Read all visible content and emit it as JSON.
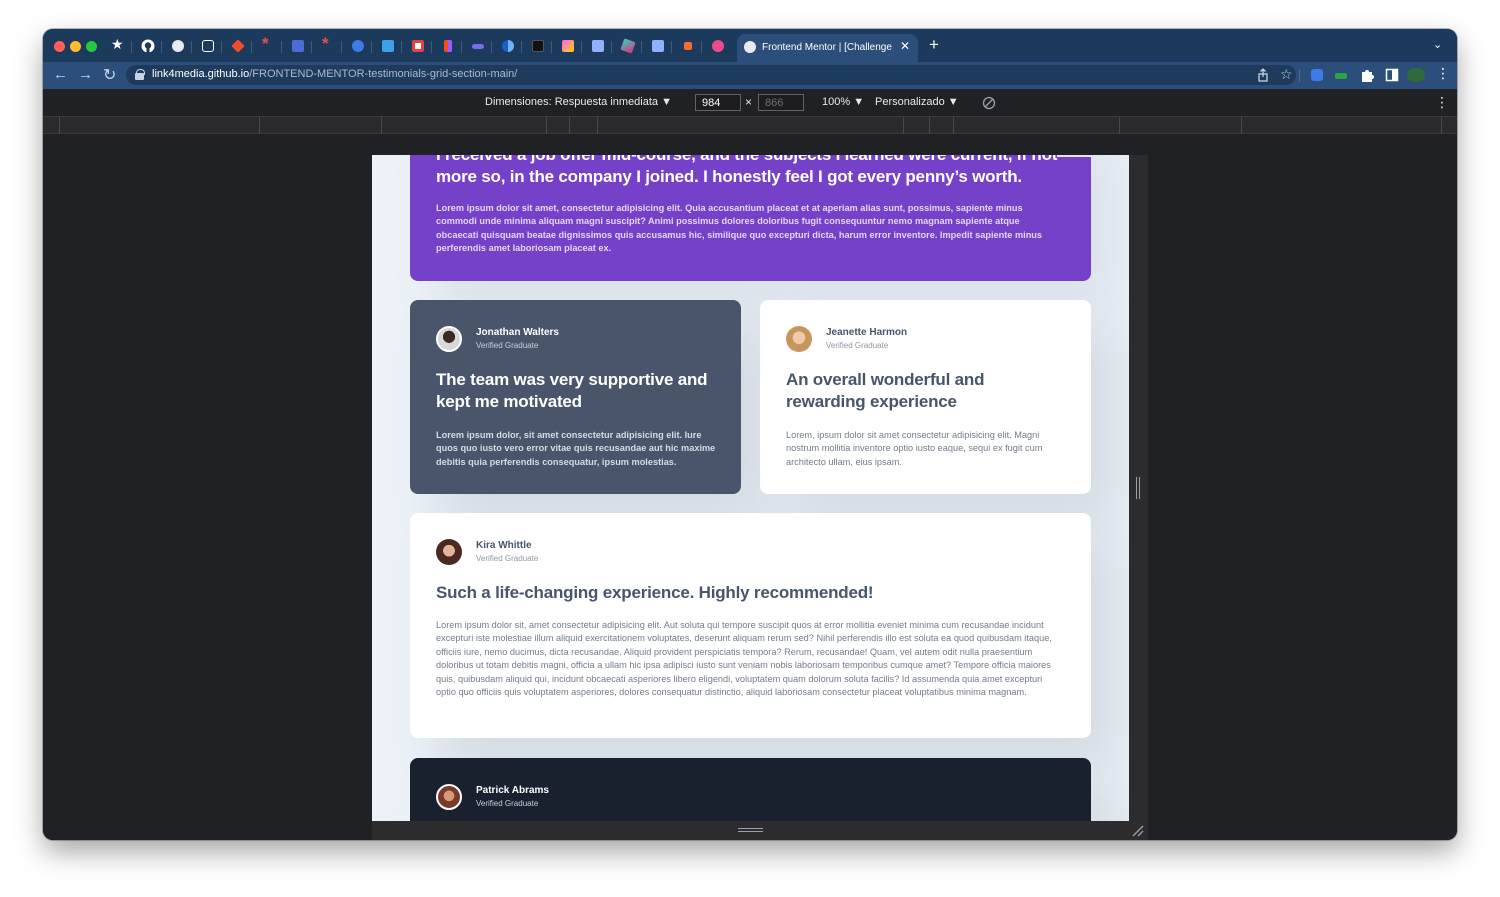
{
  "browser": {
    "active_tab": {
      "title": "Frontend Mentor | [Challenge] T",
      "close_glyph": "✕"
    },
    "pinned_tabs": [
      {
        "icon": "star-icon",
        "color": "#ffffff"
      },
      {
        "icon": "github-icon",
        "color": "#ffffff"
      },
      {
        "icon": "circle-icon",
        "color": "#ffffff"
      },
      {
        "icon": "codepen-icon",
        "color": "#ffffff"
      },
      {
        "icon": "git-icon",
        "color": "#e94e31"
      },
      {
        "icon": "asterisk-icon",
        "color": "#ee4d4d"
      },
      {
        "icon": "bluetooth-icon",
        "color": "#4b6bd6"
      },
      {
        "icon": "asterisk-icon",
        "color": "#ee4d4d"
      },
      {
        "icon": "e-badge-icon",
        "color": "#3e7be8"
      },
      {
        "icon": "a-badge-icon",
        "color": "#3ea0e8"
      },
      {
        "icon": "record-icon",
        "color": "#e84040"
      },
      {
        "icon": "figma-icon",
        "color": "#a259ff"
      },
      {
        "icon": "wave-icon",
        "color": "#7a6cf0"
      },
      {
        "icon": "half-circle-icon",
        "color": "#3b8df0"
      },
      {
        "icon": "m-badge-icon",
        "color": "#111111"
      },
      {
        "icon": "xd-icon",
        "color": "#ff61f6"
      },
      {
        "icon": "grid-icon",
        "color": "#8fb1ff"
      },
      {
        "icon": "cube-icon",
        "color": "#2ed3c4"
      },
      {
        "icon": "grid-icon",
        "color": "#8fb1ff"
      },
      {
        "icon": "arrow-icon",
        "color": "#ff6b2b"
      },
      {
        "icon": "dribbble-icon",
        "color": "#ea4c89"
      }
    ],
    "new_tab_glyph": "+",
    "tab_menu_glyph": "⌄",
    "url_host": "link4media.github.io",
    "url_path": "/FRONTEND-MENTOR-testimonials-grid-section-main/",
    "nav_back": "←",
    "nav_forward": "→",
    "nav_reload": "↻",
    "toolbar_icons": [
      "share-icon",
      "bookmark-star-icon",
      "extension-blue-icon",
      "extension-green-icon",
      "puzzle-icon",
      "sidebar-icon",
      "profile-icon",
      "menu-icon"
    ]
  },
  "devtools": {
    "dimensions_label": "Dimensiones: Respuesta inmediata ▼",
    "width_value": "984",
    "times": "×",
    "height_value": "866",
    "zoom_label": "100% ▼",
    "throttle_label": "Personalizado ▼",
    "more_glyph": "⋮"
  },
  "testimonials": {
    "daniel": {
      "quote": "I received a job offer mid-course, and the subjects I learned were current, if not more so, in the company I joined. I honestly feel I got every penny’s worth.",
      "body": "Lorem ipsum dolor sit amet, consectetur adipisicing elit. Quia accusantium placeat et at aperiam alias sunt, possimus, sapiente minus commodi unde minima aliquam magni suscipit? Animi possimus dolores doloribus fugit consequuntur nemo magnam sapiente atque obcaecati quisquam beatae dignissimos quis accusamus hic, similique quo excepturi dicta, harum error inventore. Impedit sapiente minus perferendis amet laboriosam placeat ex."
    },
    "jonathan": {
      "name": "Jonathan Walters",
      "role": "Verified Graduate",
      "quote": "The team was very supportive and kept me motivated",
      "body": "Lorem ipsum dolor, sit amet consectetur adipisicing elit. Iure quos quo iusto vero error vitae quis recusandae aut hic maxime debitis quia perferendis consequatur, ipsum molestias."
    },
    "jeanette": {
      "name": "Jeanette Harmon",
      "role": "Verified Graduate",
      "quote": "An overall wonderful and rewarding experience",
      "body": "Lorem, ipsum dolor sit amet consectetur adipisicing elit. Magni nostrum mollitia inventore optio iusto eaque, sequi ex fugit cum architecto ullam, eius ipsam."
    },
    "kira": {
      "name": "Kira Whittle",
      "role": "Verified Graduate",
      "quote": "Such a life-changing experience. Highly recommended!",
      "body": "Lorem ipsum dolor sit, amet consectetur adipisicing elit. Aut soluta qui tempore suscipit quos at error mollitia eveniet minima cum recusandae incidunt excepturi iste molestiae illum aliquid exercitationem voluptates, deserunt aliquam rerum sed? Nihil perferendis illo est soluta ea quod quibusdam itaque, officiis iure, nemo ducimus, dicta recusandae. Aliquid provident perspiciatis tempora? Rerum, recusandae! Quam, vel autem odit nulla praesentium doloribus ut totam debitis magni, officia a ullam hic ipsa adipisci iusto sunt veniam nobis laboriosam temporibus cumque amet? Tempore officia maiores quis, quibusdam aliquid qui, incidunt obcaecati asperiores libero eligendi, voluptatem quam dolorum soluta facilis? Id assumenda quia amet excepturi optio quo officiis quis voluptatem asperiores, dolores consequatur distinctio, aliquid laboriosam consectetur placeat voluptatibus minima magnam."
    },
    "patrick": {
      "name": "Patrick Abrams",
      "role": "Verified Graduate"
    }
  },
  "colors": {
    "moderate_violet": "#7541c8",
    "grayish_blue": "#48556a",
    "dark_blackish_blue": "#19212e",
    "light_gray_bg": "#ecf2f8"
  }
}
